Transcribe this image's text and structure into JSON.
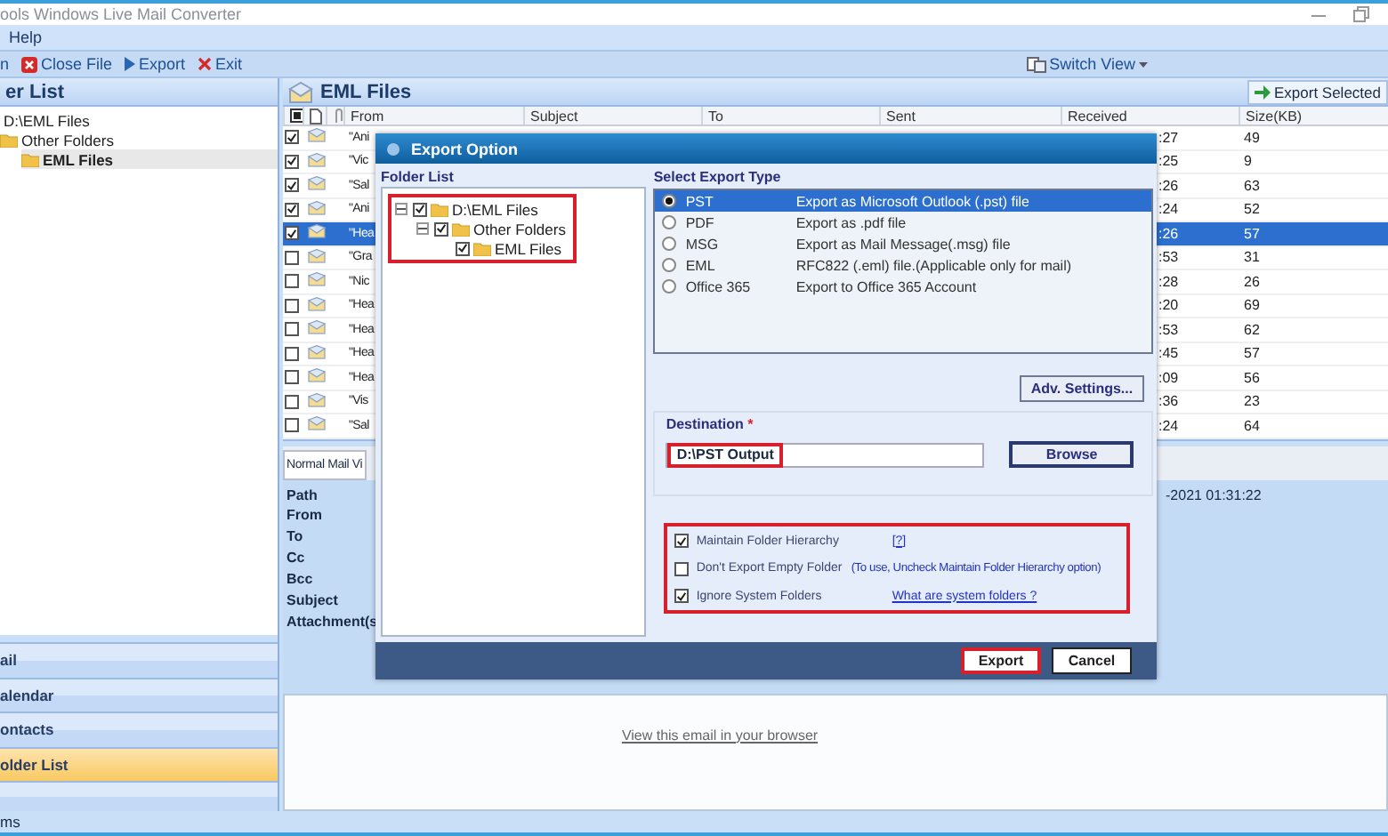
{
  "window": {
    "title": "ools Windows Live Mail Converter"
  },
  "menu": [
    {
      "label": "Help"
    }
  ],
  "toolbar": [
    {
      "label": "n",
      "kind": "text"
    },
    {
      "label": "Close File",
      "kind": "close"
    },
    {
      "label": "Export",
      "kind": "export"
    },
    {
      "label": "Exit",
      "kind": "exit"
    }
  ],
  "switch_view": {
    "label": "Switch View"
  },
  "left_panel": {
    "title": "er List",
    "tree": [
      {
        "label": "D:\\EML Files",
        "selected": false,
        "children": [
          {
            "label": "Other Folders",
            "selected": false,
            "children": [
              {
                "label": "EML Files",
                "selected": true
              }
            ]
          }
        ]
      }
    ],
    "nav": [
      {
        "label": "ail",
        "selected": false
      },
      {
        "label": "alendar",
        "selected": false
      },
      {
        "label": "ontacts",
        "selected": false
      },
      {
        "label": "older List",
        "selected": true
      }
    ]
  },
  "mail_list": {
    "title": "EML Files",
    "export_button": "Export Selected",
    "columns": [
      "From",
      "Subject",
      "To",
      "Sent",
      "Received",
      "Size(KB)"
    ],
    "rows": [
      {
        "checked": true,
        "selected": false,
        "from": "\"Ani",
        "received": ":27",
        "size": "49"
      },
      {
        "checked": true,
        "selected": false,
        "from": "\"Vic",
        "received": ":25",
        "size": "9"
      },
      {
        "checked": true,
        "selected": false,
        "from": "\"Sal",
        "received": ":26",
        "size": "63"
      },
      {
        "checked": true,
        "selected": false,
        "from": "\"Ani",
        "received": ":24",
        "size": "52"
      },
      {
        "checked": true,
        "selected": true,
        "from": "\"Hea",
        "received": ":26",
        "size": "57"
      },
      {
        "checked": false,
        "selected": false,
        "from": "\"Gra",
        "received": ":53",
        "size": "31"
      },
      {
        "checked": false,
        "selected": false,
        "from": "\"Nic",
        "received": ":28",
        "size": "26"
      },
      {
        "checked": false,
        "selected": false,
        "from": "\"Hea",
        "received": ":20",
        "size": "69"
      },
      {
        "checked": false,
        "selected": false,
        "from": "\"Hea",
        "received": ":53",
        "size": "62"
      },
      {
        "checked": false,
        "selected": false,
        "from": "\"Hea",
        "received": ":45",
        "size": "57"
      },
      {
        "checked": false,
        "selected": false,
        "from": "\"Hea",
        "received": ":09",
        "size": "56"
      },
      {
        "checked": false,
        "selected": false,
        "from": "\"Vis",
        "received": ":36",
        "size": "23"
      },
      {
        "checked": false,
        "selected": false,
        "from": "\"Sal",
        "received": ":24",
        "size": "64"
      }
    ]
  },
  "preview": {
    "tab": "Normal Mail Vi",
    "fields": [
      "Path",
      "From",
      "To",
      "Cc",
      "Bcc",
      "Subject",
      "Attachment(s"
    ],
    "date": "-2021 01:31:22",
    "body_link": "View this email in your browser"
  },
  "dialog": {
    "title": "Export Option",
    "folder_list": {
      "label": "Folder List",
      "tree": [
        {
          "label": "D:\\EML Files",
          "checked": true,
          "expanded": true,
          "children": [
            {
              "label": "Other Folders",
              "checked": true,
              "expanded": true,
              "children": [
                {
                  "label": "EML Files",
                  "checked": true
                }
              ]
            }
          ]
        }
      ]
    },
    "export_type": {
      "label": "Select Export Type",
      "options": [
        {
          "name": "PST",
          "description": "Export as Microsoft Outlook (.pst) file",
          "selected": true
        },
        {
          "name": "PDF",
          "description": "Export as .pdf file",
          "selected": false
        },
        {
          "name": "MSG",
          "description": "Export as Mail Message(.msg) file",
          "selected": false
        },
        {
          "name": "EML",
          "description": "RFC822 (.eml) file.(Applicable only for mail)",
          "selected": false
        },
        {
          "name": "Office 365",
          "description": "Export to Office 365 Account",
          "selected": false
        }
      ]
    },
    "adv_settings": "Adv. Settings...",
    "destination": {
      "label": "Destination",
      "required_mark": "*",
      "value": "D:\\PST Output",
      "browse": "Browse"
    },
    "options": [
      {
        "label": "Maintain Folder Hierarchy",
        "checked": true,
        "link": "[?]"
      },
      {
        "label": "Don't Export Empty Folder",
        "checked": false,
        "note": "(To use, Uncheck Maintain Folder Hierarchy option)"
      },
      {
        "label": "Ignore System Folders",
        "checked": true,
        "link": "What are system folders ?"
      }
    ],
    "buttons": [
      "Export",
      "Cancel"
    ]
  },
  "status_bar": {
    "text": "ms"
  }
}
